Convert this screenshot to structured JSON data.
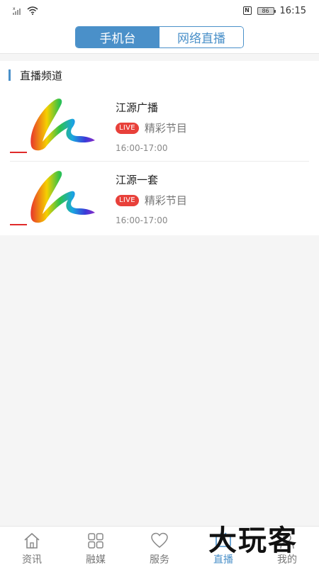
{
  "status_bar": {
    "battery": "86",
    "time": "16:15"
  },
  "header": {
    "tabs": [
      {
        "label": "手机台",
        "active": true
      },
      {
        "label": "网络直播",
        "active": false
      }
    ]
  },
  "section": {
    "title": "直播频道"
  },
  "channels": [
    {
      "name": "江源广播",
      "live_badge": "LIVE",
      "program": "精彩节目",
      "time": "16:00-17:00"
    },
    {
      "name": "江源一套",
      "live_badge": "LIVE",
      "program": "精彩节目",
      "time": "16:00-17:00"
    }
  ],
  "bottom_nav": [
    {
      "label": "资讯",
      "icon": "home-icon",
      "active": false
    },
    {
      "label": "融媒",
      "icon": "grid-icon",
      "active": false
    },
    {
      "label": "服务",
      "icon": "heart-icon",
      "active": false
    },
    {
      "label": "直播",
      "icon": "tv-icon",
      "active": true
    },
    {
      "label": "我的",
      "icon": "person-icon",
      "active": false
    }
  ],
  "watermark": "大玩客",
  "colors": {
    "accent": "#4a90c9",
    "live": "#e8403a"
  }
}
